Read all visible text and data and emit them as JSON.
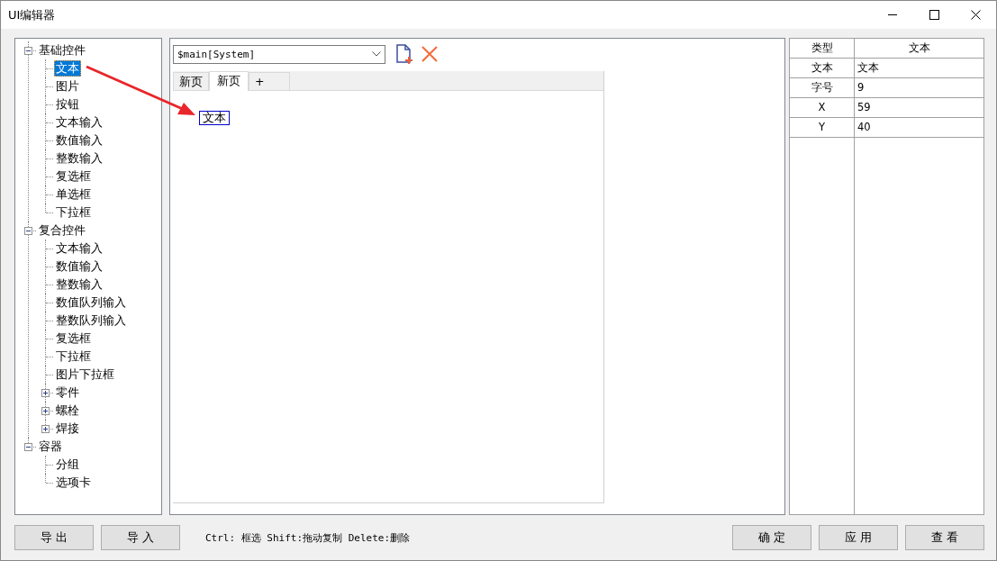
{
  "window": {
    "title": "UI编辑器"
  },
  "tree": [
    {
      "label": "基础控件",
      "expanded": true,
      "selected": false,
      "children": [
        {
          "label": "文本",
          "selected": true
        },
        {
          "label": "图片",
          "selected": false
        },
        {
          "label": "按钮",
          "selected": false
        },
        {
          "label": "文本输入",
          "selected": false
        },
        {
          "label": "数值输入",
          "selected": false
        },
        {
          "label": "整数输入",
          "selected": false
        },
        {
          "label": "复选框",
          "selected": false
        },
        {
          "label": "单选框",
          "selected": false
        },
        {
          "label": "下拉框",
          "selected": false
        }
      ]
    },
    {
      "label": "复合控件",
      "expanded": true,
      "selected": false,
      "children": [
        {
          "label": "文本输入",
          "selected": false
        },
        {
          "label": "数值输入",
          "selected": false
        },
        {
          "label": "整数输入",
          "selected": false
        },
        {
          "label": "数值队列输入",
          "selected": false
        },
        {
          "label": "整数队列输入",
          "selected": false
        },
        {
          "label": "复选框",
          "selected": false
        },
        {
          "label": "下拉框",
          "selected": false
        },
        {
          "label": "图片下拉框",
          "selected": false
        },
        {
          "label": "零件",
          "expanded": false,
          "selected": false
        },
        {
          "label": "螺栓",
          "expanded": false,
          "selected": false
        },
        {
          "label": "焊接",
          "expanded": false,
          "selected": false
        }
      ]
    },
    {
      "label": "容器",
      "expanded": true,
      "selected": false,
      "children": [
        {
          "label": "分组",
          "selected": false
        },
        {
          "label": "选项卡",
          "selected": false
        }
      ]
    }
  ],
  "editor": {
    "page_select": {
      "value": "$main[System]"
    },
    "tabs": [
      {
        "label": "新页",
        "selected": false
      },
      {
        "label": "新页",
        "selected": true
      },
      {
        "label": "+",
        "selected": false
      }
    ],
    "widgets": [
      {
        "label": "文本",
        "selected": true
      }
    ]
  },
  "properties": {
    "columns": [
      "类型",
      "文本"
    ],
    "rows": [
      {
        "name": "文本",
        "value": "文本"
      },
      {
        "name": "字号",
        "value": "9"
      },
      {
        "name": "X",
        "value": "59"
      },
      {
        "name": "Y",
        "value": "40"
      }
    ]
  },
  "left_buttons": [
    "导 出",
    "导 入"
  ],
  "hint": "Ctrl: 框选 Shift:拖动复制 Delete:删除",
  "right_buttons": [
    "确 定",
    "应 用",
    "查 看"
  ]
}
